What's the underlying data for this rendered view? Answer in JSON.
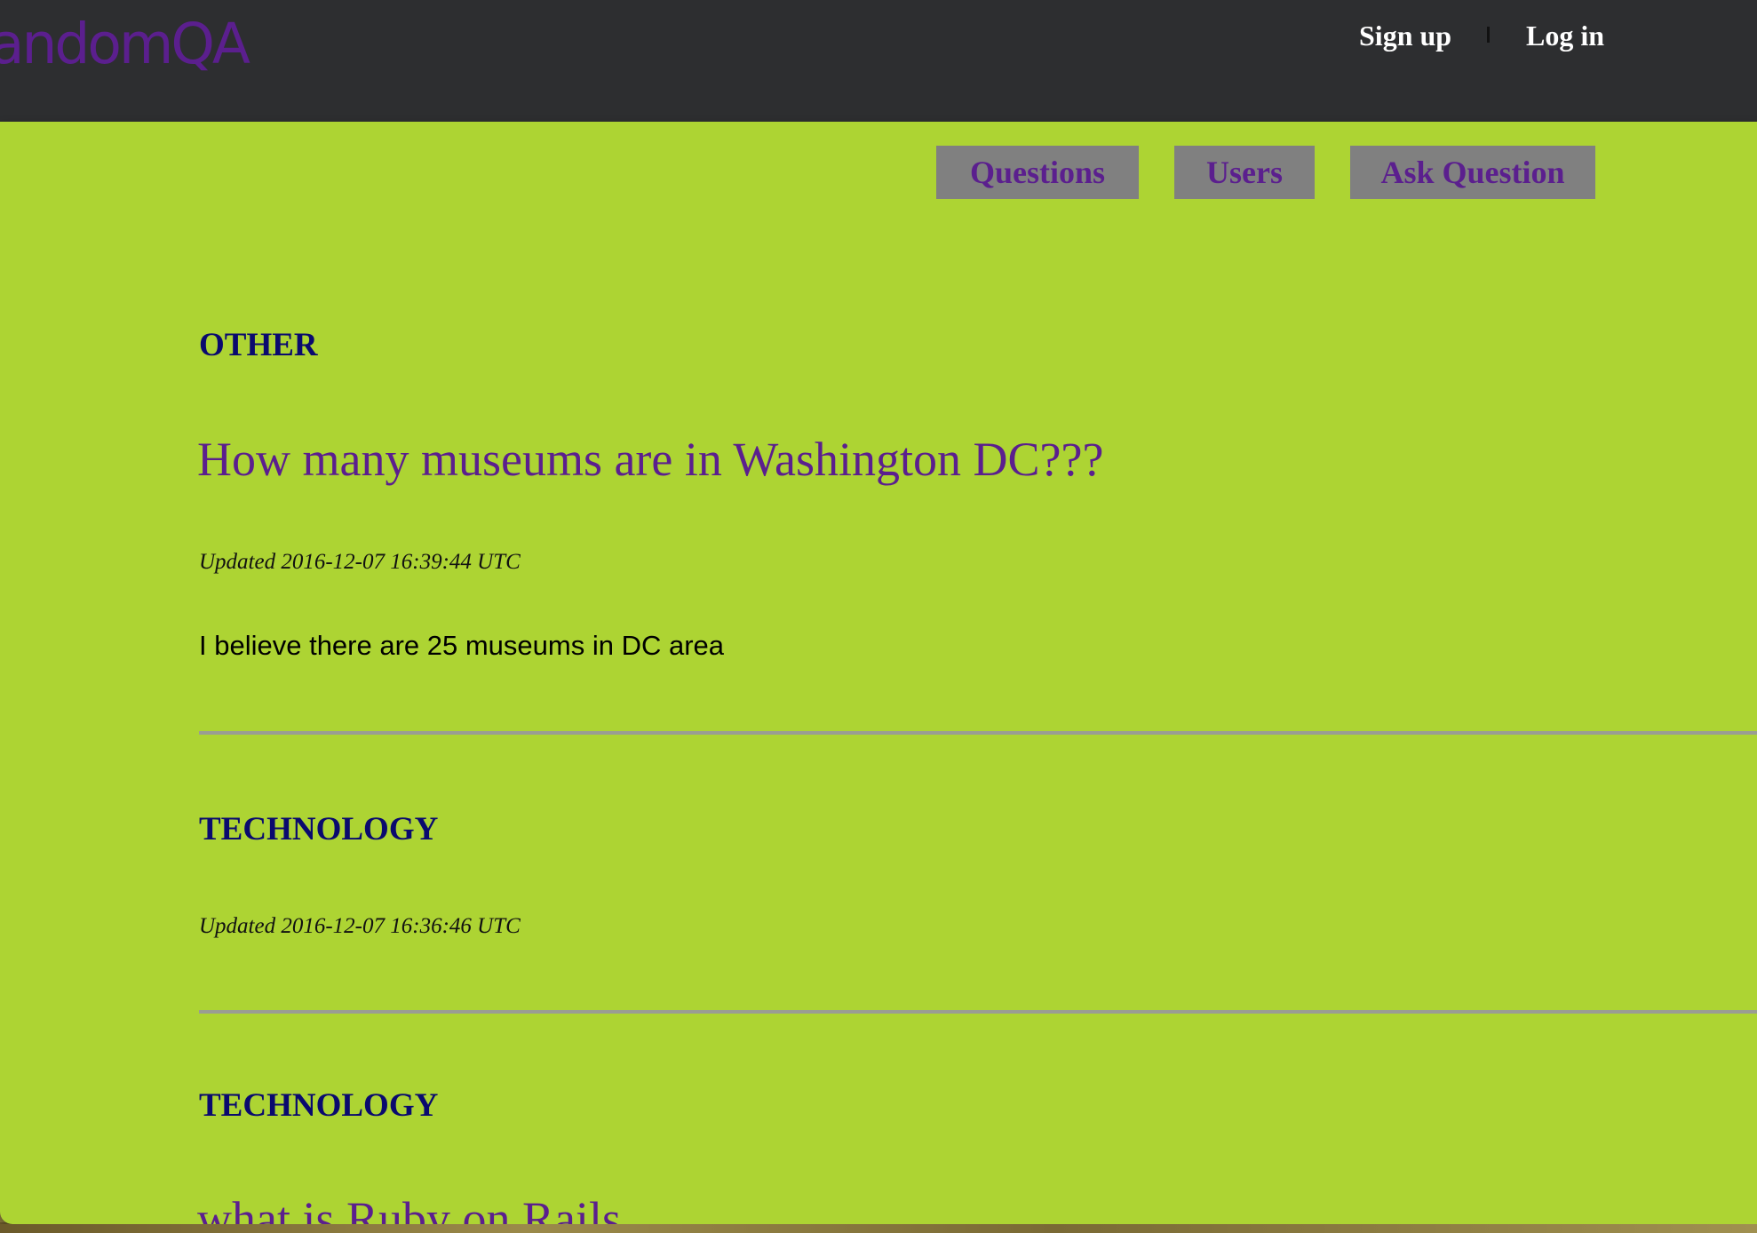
{
  "header": {
    "logo_text": "randomQA",
    "signup_label": "Sign up",
    "login_label": "Log in"
  },
  "nav": {
    "questions_label": "Questions",
    "users_label": "Users",
    "ask_label": "Ask Question"
  },
  "posts": [
    {
      "category": "OTHER",
      "title": "How many museums are in Washington DC???",
      "updated": "Updated 2016-12-07 16:39:44 UTC",
      "answer": "I believe there are 25 museums in DC area"
    },
    {
      "category": "TECHNOLOGY",
      "updated": "Updated 2016-12-07 16:36:46 UTC"
    },
    {
      "category": "TECHNOLOGY",
      "title": "what is Ruby on Rails"
    }
  ],
  "colors": {
    "topbar": "#2d2e30",
    "panel": "#add433",
    "accent_purple": "#5b1f8e",
    "category_navy": "#0a0a6e",
    "nav_button_bg": "#808080"
  }
}
